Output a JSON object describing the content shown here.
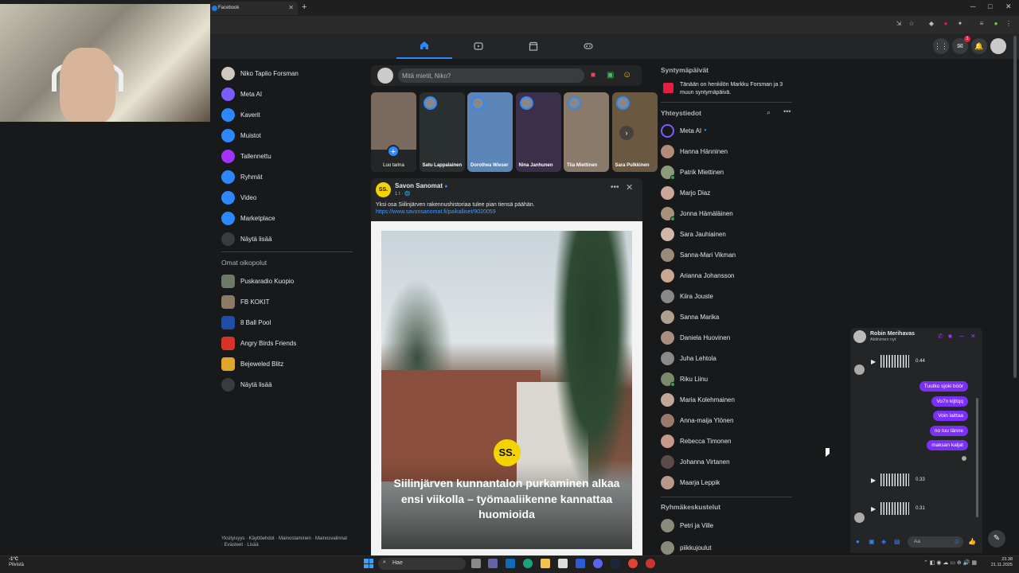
{
  "browser": {
    "tab_title": "Facebook",
    "tab_close": "✕",
    "new_tab": "+",
    "win_min": "─",
    "win_max": "□",
    "win_close": "✕"
  },
  "left_nav": {
    "profile_name": "Niko Taplio Forsman",
    "items": [
      {
        "label": "Meta AI",
        "icon": "meta-ai-icon",
        "color": "#7a5cff"
      },
      {
        "label": "Kaverit",
        "icon": "friends-icon",
        "color": "#2d88ff"
      },
      {
        "label": "Muistot",
        "icon": "memories-icon",
        "color": "#2d88ff"
      },
      {
        "label": "Tallennettu",
        "icon": "saved-icon",
        "color": "#a033ff"
      },
      {
        "label": "Ryhmät",
        "icon": "groups-icon",
        "color": "#2d88ff"
      },
      {
        "label": "Video",
        "icon": "video-icon",
        "color": "#2d88ff"
      },
      {
        "label": "Marketplace",
        "icon": "marketplace-icon",
        "color": "#2d88ff"
      },
      {
        "label": "Näytä lisää",
        "icon": "chevron-down-icon",
        "color": "#3a3b3c"
      }
    ],
    "shortcuts_title": "Omat oikopolut",
    "shortcuts": [
      {
        "label": "Puskaradio Kuopio",
        "color": "#6d7a6a"
      },
      {
        "label": "FB KOKIT",
        "color": "#8a7a66"
      },
      {
        "label": "8 Ball Pool",
        "color": "#1e4fa8"
      },
      {
        "label": "Angry Birds Friends",
        "color": "#d8332b"
      },
      {
        "label": "Bejeweled Blitz",
        "color": "#e0a82a"
      },
      {
        "label": "Näytä lisää",
        "color": "#3a3b3c"
      }
    ],
    "footer": "Yksityisyys · Käyttöehdot · Mainostaminen · Mainosvalinnat · Evästeet · Lisää"
  },
  "composer": {
    "placeholder": "Mitä mietit, Niko?"
  },
  "stories": [
    {
      "name": "Luo tarina",
      "color": "#555"
    },
    {
      "name": "Satu Lappalainen",
      "color": "#2a2f30"
    },
    {
      "name": "Dorothea Wieser",
      "color": "#5d86b8"
    },
    {
      "name": "Nina Janhunen",
      "color": "#3b2f4a"
    },
    {
      "name": "Tiia Miettinen",
      "color": "#8a7a6a"
    },
    {
      "name": "Sara Pulkkinen",
      "color": "#6a5840"
    }
  ],
  "post": {
    "author": "Savon Sanomat",
    "logo_text": "SS.",
    "time": "1 t · 🌐",
    "text": "Yksi osa Siilinjärven rakennushistoriaa tulee pian tiensä päähän.",
    "link": "https://www.savonsanomat.fi/paikalliset/9020059",
    "headline": "Siilinjärven kunnantalon purkaminen alkaa ensi viikolla – työmaaliikenne kannattaa huomioida"
  },
  "right": {
    "birthdays_title": "Syntymäpäivät",
    "birthday_text": "Tänään on henkilön Markku Forsman ja 3 muun syntymäpäivä.",
    "contacts_title": "Yhteystiedot",
    "contacts": [
      {
        "name": "Meta AI",
        "online": false
      },
      {
        "name": "Hanna Hänninen",
        "online": false
      },
      {
        "name": "Patrik Miettinen",
        "online": true
      },
      {
        "name": "Marjo Diaz",
        "online": false
      },
      {
        "name": "Jonna Hämäläinen",
        "online": true
      },
      {
        "name": "Sara Jauhiainen",
        "online": false
      },
      {
        "name": "Sanna-Mari Vikman",
        "online": false
      },
      {
        "name": "Arianna Johansson",
        "online": false
      },
      {
        "name": "Kiira Jouste",
        "online": false
      },
      {
        "name": "Sanna Marika",
        "online": false
      },
      {
        "name": "Daniela Huovinen",
        "online": false
      },
      {
        "name": "Juha Lehtola",
        "online": false
      },
      {
        "name": "Riku Liinu",
        "online": true
      },
      {
        "name": "Maria Kolehmainen",
        "online": false
      },
      {
        "name": "Anna-maija Ylönen",
        "online": false
      },
      {
        "name": "Rebecca Timonen",
        "online": false
      },
      {
        "name": "Johanna Virtanen",
        "online": false
      },
      {
        "name": "Maarja Leppik",
        "online": false
      }
    ],
    "group_chats_title": "Ryhmäkeskustelut",
    "group_chats": [
      {
        "name": "Petri ja Ville"
      },
      {
        "name": "piikkujoulut"
      }
    ]
  },
  "chat": {
    "name": "Robin Merihavas",
    "status": "Aktiivinen nyt",
    "voice_durations": [
      "0.44",
      "0.33",
      "0.31"
    ],
    "messages": [
      "Tuutko sjoki böör",
      "Vo7n kijttqq",
      "Voin laittaa",
      "no tuu tänne",
      "maksan kaljat"
    ],
    "input_placeholder": "Aa"
  },
  "taskbar": {
    "weather_temp": "-1°C",
    "weather_desc": "Pilvistä",
    "search_label": "Hae",
    "time": "23.38",
    "date": "21.11.2025"
  }
}
